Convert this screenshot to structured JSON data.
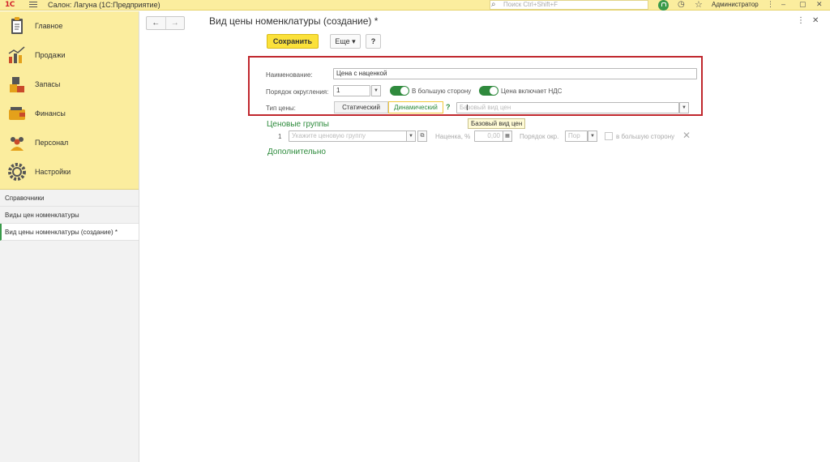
{
  "topbar": {
    "logo": "1С",
    "title": "Салон: Лагуна  (1С:Предприятие)",
    "search_placeholder": "Поиск Ctrl+Shift+F",
    "user": "Администратор",
    "more": "⋮",
    "minimize": "–",
    "restore": "▢",
    "close": "✕"
  },
  "sidebar": {
    "sections": [
      {
        "label": "Главное"
      },
      {
        "label": "Продажи"
      },
      {
        "label": "Запасы"
      },
      {
        "label": "Финансы"
      },
      {
        "label": "Персонал"
      },
      {
        "label": "Настройки"
      }
    ],
    "links": [
      {
        "label": "Справочники"
      },
      {
        "label": "Виды цен номенклатуры"
      },
      {
        "label": "Вид цены номенклатуры (создание) *"
      }
    ]
  },
  "form": {
    "title": "Вид цены номенклатуры (создание) *",
    "more_menu": "⋮",
    "close": "✕",
    "back_arrow": "←",
    "forward_arrow": "→",
    "save_label": "Сохранить",
    "more_label": "Еще ▾",
    "help_label": "?",
    "name_label": "Наименование:",
    "name_value": "Цена с наценкой",
    "rounding_label": "Порядок округления:",
    "rounding_value": "1",
    "round_up_label": "В большую сторону",
    "round_up_on": true,
    "vat_label": "Цена включает НДС",
    "vat_on": true,
    "price_type_label": "Тип цены:",
    "price_type_options": [
      "Статический",
      "Динамический"
    ],
    "price_type_selected": "Динамический",
    "help_link": "?",
    "base_price_placeholder": "Базовый вид цен",
    "tooltip": "Базовый вид цен",
    "price_groups_title": "Ценовые группы",
    "group_row": {
      "number": "1",
      "group_placeholder": "Укажите ценовую группу",
      "markup_label": "Наценка, %",
      "markup_value": "0,00",
      "rounding_label": "Порядок окр.",
      "rounding_placeholder": "Пор",
      "round_up_label": "в большую сторону"
    },
    "additional_title": "Дополнительно"
  },
  "colors": {
    "accent_yellow": "#fbed9e",
    "save_button": "#fbe13a",
    "green": "#2c8a3b",
    "highlight_red": "#c0272d"
  }
}
